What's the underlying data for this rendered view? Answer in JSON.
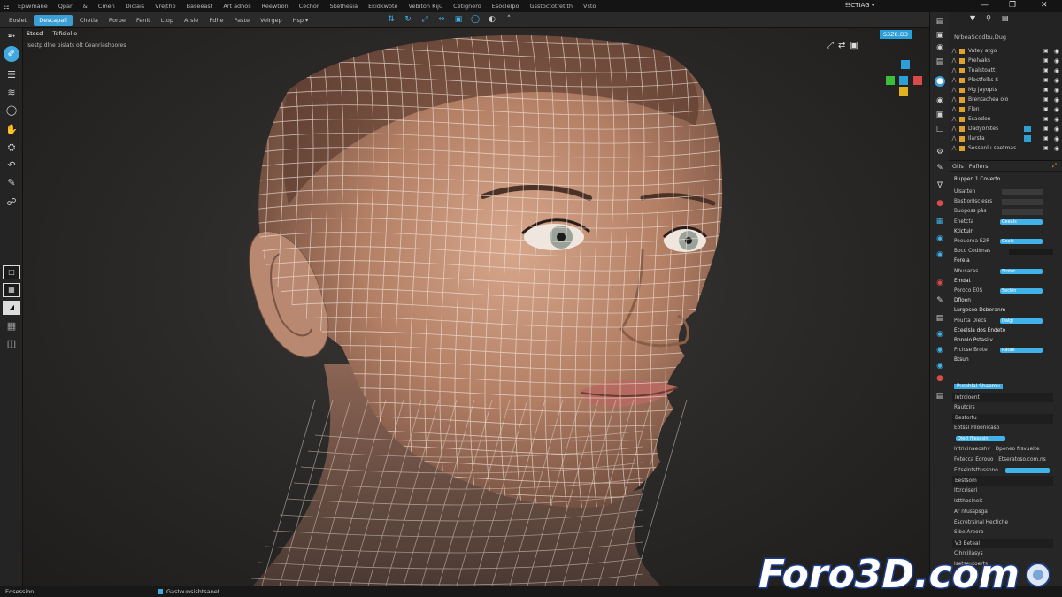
{
  "menubar": {
    "logo": "☷",
    "items": [
      "Epiwmane",
      "Qpar",
      "&",
      "Cmen",
      "Diclais",
      "Vrejtho",
      "Baseeast",
      "Art adhos",
      "Reewtion",
      "Cechor",
      "Skethesia",
      "Ekidkwote",
      "Vebiton Kiju",
      "Cetignero",
      "Esoclelpo",
      "Gsstoctotretith",
      "Vsto"
    ],
    "center_title": "☷CTIAG ▾",
    "controls": [
      "—",
      "❐",
      "✕"
    ]
  },
  "toolbar2": {
    "items": [
      "Boslet",
      "Descapall",
      "Chetia",
      "Rorpe",
      "Fenit",
      "Ltop",
      "Arsie",
      "Pdhe",
      "Paste",
      "Velrgep",
      "Hsp ▾"
    ],
    "active_index": 1
  },
  "viewport": {
    "mode": "Stoscl",
    "view": "Tofisiolle",
    "sub": "Isestp dlne pislats olt Ceanriashpores",
    "topright": "S3Z8:D3"
  },
  "outliner": {
    "title": "NrbeaScodbu,Dug",
    "rows": [
      {
        "name": "Vatey atgo",
        "badge": false
      },
      {
        "name": "Prelvaks",
        "badge": false
      },
      {
        "name": "Tnalstoatt",
        "badge": false
      },
      {
        "name": "Plostfolks S",
        "badge": false
      },
      {
        "name": "Mg jayopts",
        "badge": false
      },
      {
        "name": "Brentachea olo",
        "badge": false
      },
      {
        "name": "Flen",
        "badge": false
      },
      {
        "name": "Esaedon",
        "badge": false
      },
      {
        "name": "Dadyorstes",
        "badge": true
      },
      {
        "name": "Ilarsta",
        "badge": true
      },
      {
        "name": "Sossenlu seetmas",
        "badge": false
      }
    ]
  },
  "properties": {
    "tab": "Gtis",
    "tab2": "Pafiers",
    "header": "Ruppen 1 Coverto",
    "rows": [
      {
        "label": "Ulsatten",
        "kind": "field"
      },
      {
        "label": "Bestionlsciesrs",
        "kind": "field"
      },
      {
        "label": "Buoposs pàs",
        "kind": "field"
      },
      {
        "label": "Enetcta",
        "kind": "slider",
        "value": "Ceeals"
      },
      {
        "label": "Ktictuin",
        "kind": "section"
      },
      {
        "label": "Poeuerea  E2P",
        "kind": "slider",
        "value": "Ceals"
      },
      {
        "label": "Boco   Codimas",
        "kind": "dark"
      },
      {
        "label": "Forela",
        "kind": "section"
      },
      {
        "label": "Nbusaras",
        "kind": "slider",
        "value": "Stotor"
      },
      {
        "label": "Emdat",
        "kind": "section"
      },
      {
        "label": "Poroco  E0S",
        "kind": "slider",
        "value": "Seckin"
      },
      {
        "label": "Dfloen",
        "kind": "section"
      },
      {
        "label": "Lurgeseo Dsberanm",
        "kind": "section"
      },
      {
        "label": "Pourta  Diecs",
        "kind": "slider",
        "value": "Dalgi"
      },
      {
        "label": "Eceelsla dos Endeto",
        "kind": "section"
      },
      {
        "label": "Bonnlo Pstasiiv",
        "kind": "section"
      },
      {
        "label": "Prcicse  Brote",
        "kind": "slider",
        "value": "Ratae"
      },
      {
        "label": "Btsun",
        "kind": "section"
      }
    ],
    "highlight": "Pureblal Sbaemu",
    "lower": [
      {
        "label": "Intrcloent",
        "kind": "bar"
      },
      {
        "label": "Rautcirs",
        "kind": "plain"
      },
      {
        "label": "Bestortu",
        "kind": "bar"
      },
      {
        "label": "Eotssi Piloonicaso",
        "kind": "plain"
      },
      {
        "label": "Diecl fliesasin",
        "kind": "slider2"
      },
      {
        "label": "Intricinaeoshv Dpeneo frsvuelte",
        "kind": "plain"
      },
      {
        "label": "Fetecca Eorouo Etseratoso.com.ns",
        "kind": "plain"
      },
      {
        "label": "Eltseintsttussono",
        "kind": "slider3"
      },
      {
        "label": "Eestsom",
        "kind": "bar"
      },
      {
        "label": "Ittrcriseri",
        "kind": "plain"
      },
      {
        "label": "Istthosinelt",
        "kind": "plain"
      },
      {
        "label": "Ar ntusspsga",
        "kind": "plain"
      },
      {
        "label": "Escretrsinal Hectiche",
        "kind": "plain"
      },
      {
        "label": "Sibe Areoro",
        "kind": "plain"
      },
      {
        "label": "V3 Beteal",
        "kind": "bar"
      },
      {
        "label": "Cihrcillasys",
        "kind": "plain"
      },
      {
        "label": "Isetseutoerts",
        "kind": "plain"
      }
    ]
  },
  "statusbar": {
    "left": "Edsession.",
    "mid": "Gastounsishtsanet"
  },
  "watermark": "Foro3D.com"
}
